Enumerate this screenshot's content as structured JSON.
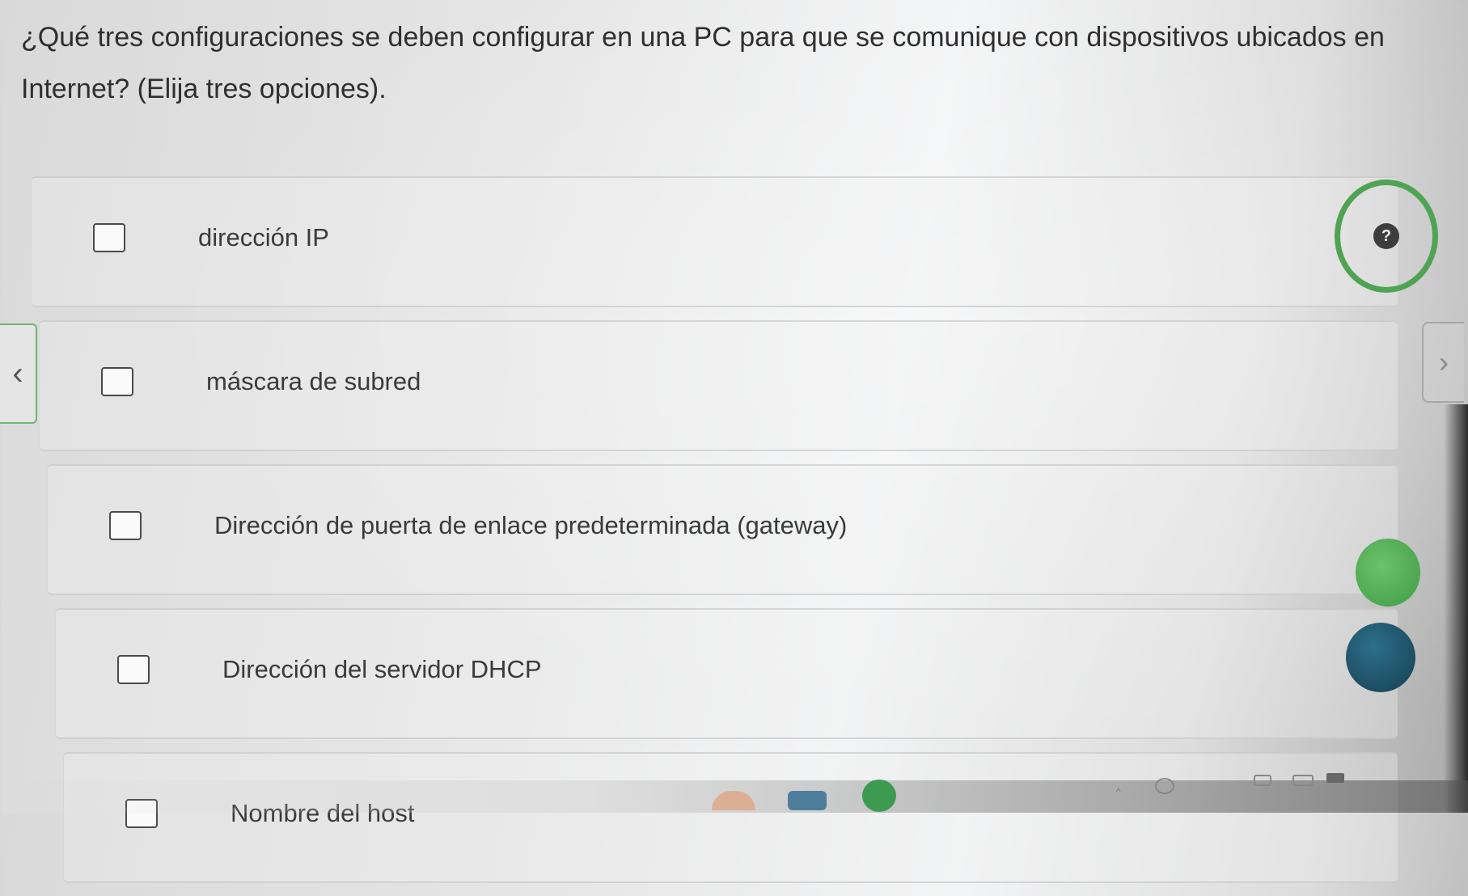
{
  "question": {
    "text": "¿Qué tres configuraciones se deben configurar en una PC para que se comunique con dispositivos ubicados en Internet? (Elija tres opciones)."
  },
  "options": [
    {
      "label": "dirección IP",
      "checked": false
    },
    {
      "label": "máscara de subred",
      "checked": false
    },
    {
      "label": "Dirección de puerta de enlace predeterminada (gateway)",
      "checked": false
    },
    {
      "label": "Dirección del servidor DHCP",
      "checked": false
    },
    {
      "label": "Nombre del host",
      "checked": false
    }
  ],
  "nav": {
    "prev_icon": "chevron-left-icon",
    "next_icon": "chevron-right-icon"
  },
  "help": {
    "icon": "help-icon"
  },
  "colors": {
    "accent_green": "#4fa352",
    "checkbox_border": "#4a4a4a",
    "text": "#3a3a3a"
  }
}
